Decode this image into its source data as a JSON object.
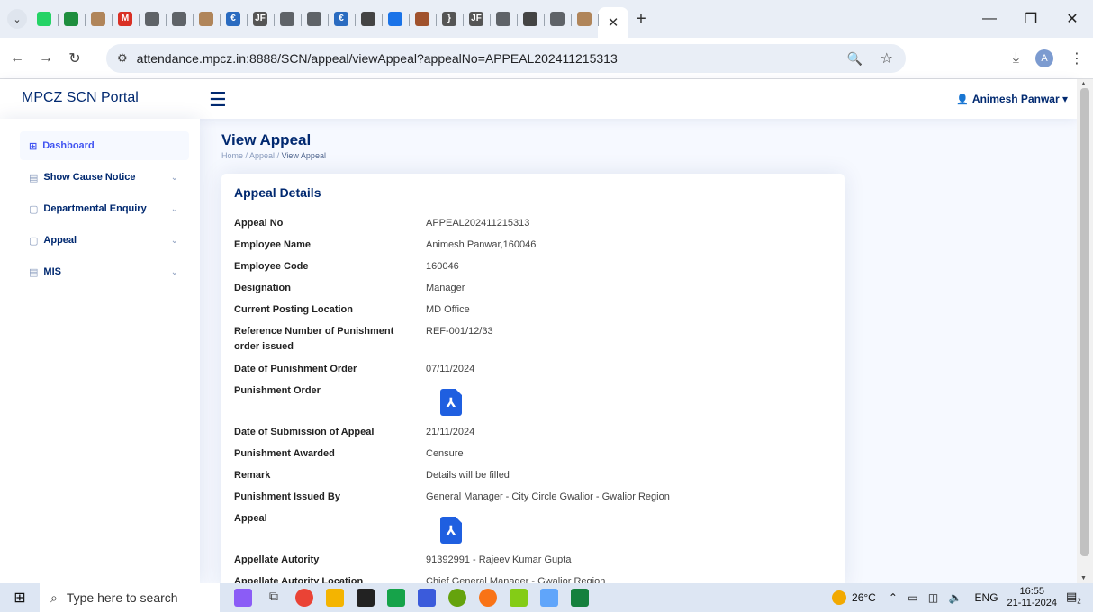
{
  "browser": {
    "url": "attendance.mpcz.in:8888/SCN/appeal/viewAppeal?appealNo=APPEAL202411215313",
    "tab_favicons": [
      {
        "label": "",
        "color": "#25d366"
      },
      {
        "label": "",
        "color": "#1e8e3e"
      },
      {
        "label": "",
        "color": "#b0855a"
      },
      {
        "label": "M",
        "color": "#d93025"
      },
      {
        "label": "",
        "color": "#5f6368"
      },
      {
        "label": "",
        "color": "#5f6368"
      },
      {
        "label": "",
        "color": "#b0855a"
      },
      {
        "label": "€",
        "color": "#2a6bc0"
      },
      {
        "label": "JF",
        "color": "#555555"
      },
      {
        "label": "",
        "color": "#5f6368"
      },
      {
        "label": "",
        "color": "#5f6368"
      },
      {
        "label": "€",
        "color": "#2a6bc0"
      },
      {
        "label": "",
        "color": "#444444"
      },
      {
        "label": "",
        "color": "#1a73e8"
      },
      {
        "label": "",
        "color": "#a0522d"
      },
      {
        "label": "}",
        "color": "#555555"
      },
      {
        "label": "JF",
        "color": "#555555"
      },
      {
        "label": "",
        "color": "#5f6368"
      },
      {
        "label": "",
        "color": "#444444"
      },
      {
        "label": "",
        "color": "#5f6368"
      },
      {
        "label": "",
        "color": "#b0855a"
      }
    ],
    "profile_initial": "A"
  },
  "app": {
    "brand": "MPCZ SCN Portal",
    "user_name": "Animesh Panwar"
  },
  "sidebar": {
    "items": [
      {
        "label": "Dashboard",
        "icon": "grid-icon",
        "active": true,
        "has_submenu": false
      },
      {
        "label": "Show Cause Notice",
        "icon": "menu-icon",
        "active": false,
        "has_submenu": true
      },
      {
        "label": "Departmental Enquiry",
        "icon": "document-icon",
        "active": false,
        "has_submenu": true
      },
      {
        "label": "Appeal",
        "icon": "document-icon",
        "active": false,
        "has_submenu": true
      },
      {
        "label": "MIS",
        "icon": "menu-icon",
        "active": false,
        "has_submenu": true
      }
    ]
  },
  "page": {
    "title": "View Appeal",
    "breadcrumb": [
      "Home",
      "Appeal",
      "View Appeal"
    ]
  },
  "card": {
    "title": "Appeal Details",
    "rows": [
      {
        "label": "Appeal No",
        "value": "APPEAL202411215313"
      },
      {
        "label": "Employee Name",
        "value": "Animesh Panwar,160046"
      },
      {
        "label": "Employee Code",
        "value": "160046"
      },
      {
        "label": "Designation",
        "value": "Manager"
      },
      {
        "label": "Current Posting Location",
        "value": "MD Office"
      },
      {
        "label": "Reference Number of Punishment order issued",
        "value": "REF-001/12/33"
      },
      {
        "label": "Date of Punishment Order",
        "value": "07/11/2024"
      },
      {
        "label": "Punishment Order",
        "value": "",
        "pdf": true
      },
      {
        "label": "Date of Submission of Appeal",
        "value": "21/11/2024"
      },
      {
        "label": "Punishment Awarded",
        "value": "Censure"
      },
      {
        "label": "Remark",
        "value": "Details will be filled"
      },
      {
        "label": "Punishment Issued By",
        "value": "General Manager - City Circle Gwalior - Gwalior Region"
      },
      {
        "label": "Appeal",
        "value": "",
        "pdf": true
      },
      {
        "label": "Appellate Autority",
        "value": "91392991 - Rajeev Kumar Gupta"
      },
      {
        "label": "Appellate Autority Location",
        "value": "Chief General Manager - Gwalior Region"
      }
    ]
  },
  "taskbar": {
    "search_placeholder": "Type here to search",
    "temperature": "26°C",
    "language": "ENG",
    "time": "16:55",
    "date": "21-11-2024",
    "notification_count": "2"
  },
  "colors": {
    "primary": "#012970",
    "accent": "#4154f1",
    "pdf": "#1f5fe0",
    "background": "#f6f9ff"
  }
}
